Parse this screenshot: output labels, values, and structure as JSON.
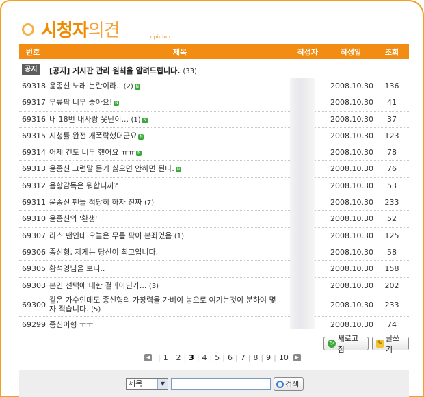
{
  "header": {
    "title_bold": "시청자",
    "title_light": "의견",
    "subtitle": "opinion"
  },
  "columns": {
    "no": "번호",
    "title": "제목",
    "author": "작성자",
    "date": "작성일",
    "views": "조회"
  },
  "notice": {
    "badge": "공지",
    "title": "[공지] 게시판 관리 원칙을 알려드립니다.",
    "count": "(33)"
  },
  "posts": [
    {
      "no": "69318",
      "title": "윤종신 노래 논란이라..",
      "count": "(2)",
      "new": true,
      "date": "2008.10.30",
      "views": "136"
    },
    {
      "no": "69317",
      "title": "무릎팍 너무 좋아요!",
      "count": "",
      "new": true,
      "date": "2008.10.30",
      "views": "41"
    },
    {
      "no": "69316",
      "title": "내 18번 내사랑 못난이...",
      "count": "(1)",
      "new": true,
      "date": "2008.10.30",
      "views": "37"
    },
    {
      "no": "69315",
      "title": "시청률 완전 개폭락했더군요",
      "count": "",
      "new": true,
      "date": "2008.10.30",
      "views": "123"
    },
    {
      "no": "69314",
      "title": "어제 건도 너무 했어요 ㅠㅠ",
      "count": "",
      "new": true,
      "date": "2008.10.30",
      "views": "78"
    },
    {
      "no": "69313",
      "title": "윤종신 그런말 듣기 싫으면 안하면 된다.",
      "count": "",
      "new": true,
      "date": "2008.10.30",
      "views": "76"
    },
    {
      "no": "69312",
      "title": "음향감독은 뭐합니까?",
      "count": "",
      "new": false,
      "date": "2008.10.30",
      "views": "53"
    },
    {
      "no": "69311",
      "title": "윤종신 팬들 적당히 하자 진짜",
      "count": "(7)",
      "new": false,
      "date": "2008.10.30",
      "views": "233"
    },
    {
      "no": "69310",
      "title": "윤종신의 '환생'",
      "count": "",
      "new": false,
      "date": "2008.10.30",
      "views": "52"
    },
    {
      "no": "69307",
      "title": "라스 팬인데 오늘은 무릎 팍이 본좌였음",
      "count": "(1)",
      "new": false,
      "date": "2008.10.30",
      "views": "125"
    },
    {
      "no": "69306",
      "title": "종신형, 제게는 당신이 최고입니다.",
      "count": "",
      "new": false,
      "date": "2008.10.30",
      "views": "58"
    },
    {
      "no": "69305",
      "title": "황석영님을 보니..",
      "count": "",
      "new": false,
      "date": "2008.10.30",
      "views": "158"
    },
    {
      "no": "69303",
      "title": "본인 선택에 대한 결과아닌가...",
      "count": "(3)",
      "new": false,
      "date": "2008.10.30",
      "views": "202"
    },
    {
      "no": "69300",
      "title": "같은 가수인데도 종신형의 가창력을 가벼이 농으로 여기는것이 분하여 몇자 적습니다.",
      "count": "(5)",
      "new": false,
      "date": "2008.10.30",
      "views": "233",
      "tall": true
    },
    {
      "no": "69299",
      "title": "종신이형 ㅜㅜ",
      "count": "",
      "new": false,
      "date": "2008.10.30",
      "views": "74"
    }
  ],
  "buttons": {
    "refresh": "새로고침",
    "write": "글쓰기"
  },
  "icons": {
    "new": "new-badge-icon",
    "refresh": "refresh-icon",
    "write": "pencil-icon",
    "search": "magnifier-icon",
    "prev": "prev-arrow-icon",
    "next": "next-arrow-icon"
  },
  "pagination": {
    "pages": [
      "1",
      "2",
      "3",
      "4",
      "5",
      "6",
      "7",
      "8",
      "9",
      "10"
    ],
    "current": "3"
  },
  "search": {
    "field_option": "제목",
    "input_value": "",
    "button": "검색"
  },
  "colors": {
    "accent": "#f28c12",
    "new_badge": "#3aa83a"
  }
}
